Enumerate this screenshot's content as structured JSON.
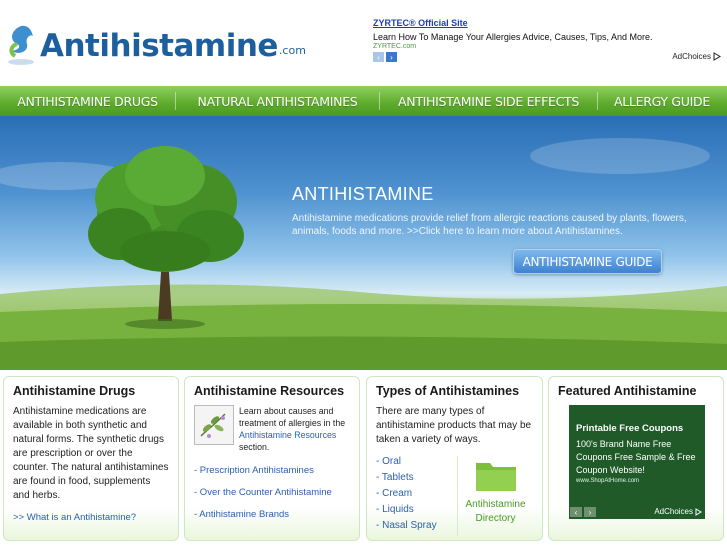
{
  "header": {
    "logo_name": "Antihistamine",
    "logo_tld": ".com"
  },
  "top_ad": {
    "title": "ZYRTEC® Official Site",
    "description": "Learn How To Manage Your Allergies Advice, Causes, Tips, And More.",
    "url": "ZYRTEC.com",
    "prev_icon": "chevron-left-icon",
    "next_icon": "chevron-right-icon",
    "adchoices": "AdChoices"
  },
  "nav": {
    "items": [
      {
        "label": "ANTIHISTAMINE DRUGS"
      },
      {
        "label": "NATURAL ANTIHISTAMINES"
      },
      {
        "label": "ANTIHISTAMINE SIDE EFFECTS"
      },
      {
        "label": "ALLERGY GUIDE"
      }
    ]
  },
  "hero": {
    "title": "ANTIHISTAMINE",
    "text": "Antihistamine medications provide relief from allergic reactions caused by plants, flowers, animals, foods and more. >>Click here to learn more about Antihistamines.",
    "button": "ANTIHISTAMINE GUIDE"
  },
  "boxes": {
    "drugs": {
      "title": "Antihistamine Drugs",
      "text": "Antihistamine medications are available in both synthetic and natural forms. The synthetic drugs are prescription or over the counter. The natural antihistamines are found in food, supplements and herbs.",
      "link": ">> What is an Antihistamine?"
    },
    "resources": {
      "title": "Antihistamine Resources",
      "intro_before": "Learn about causes and treatment of allergies in the ",
      "intro_link": "Antihistamine Resources",
      "intro_after": " section.",
      "links": [
        {
          "label": "- Prescription Antihistamines"
        },
        {
          "label": "- Over the Counter Antihistamine"
        },
        {
          "label": "- Antihistamine Brands"
        }
      ]
    },
    "types": {
      "title": "Types of Antihistamines",
      "text": "There are many types of antihistamine products that may be taken a variety of ways.",
      "items": [
        {
          "label": "- Oral"
        },
        {
          "label": "- Tablets"
        },
        {
          "label": "- Cream"
        },
        {
          "label": "- Liquids"
        },
        {
          "label": "- Nasal Spray"
        }
      ],
      "directory_line1": "Antihistamine",
      "directory_line2": "Directory"
    },
    "featured": {
      "title": "Featured Antihistamine",
      "ad_title": "Printable Free Coupons",
      "ad_desc": "100's Brand Name Free Coupons Free Sample & Free Coupon Website!",
      "ad_url": "www.ShopAtHome.com",
      "ad_choices": "AdChoices"
    }
  },
  "colors": {
    "brand_blue": "#1d5f9e",
    "nav_green": "#5daa2c",
    "link_blue": "#2a5fb0",
    "directory_green": "#4a9a22"
  }
}
